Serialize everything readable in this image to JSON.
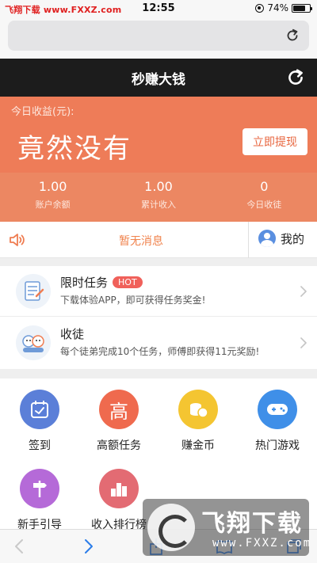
{
  "status_bar": {
    "watermark_prefix": "飞翔下载",
    "watermark_url": "www.FXXZ.com",
    "time": "12:55",
    "battery": "74%",
    "battery_level": 0.74
  },
  "app_bar": {
    "title": "秒赚大钱"
  },
  "earnings": {
    "label": "今日收益(元):",
    "amount_text": "竟然没有",
    "withdraw_label": "立即提现",
    "stats": [
      {
        "value": "1.00",
        "label": "账户余额"
      },
      {
        "value": "1.00",
        "label": "累计收入"
      },
      {
        "value": "0",
        "label": "今日收徒"
      }
    ]
  },
  "notice": {
    "message": "暂无消息",
    "mine_label": "我的"
  },
  "tasks": [
    {
      "title": "限时任务",
      "badge": "HOT",
      "desc": "下载体验APP，即可获得任务奖金!"
    },
    {
      "title": "收徒",
      "badge": "",
      "desc": "每个徒弟完成10个任务，师傅即获得11元奖励!"
    }
  ],
  "grid": [
    {
      "label": "签到",
      "icon": "calendar-check-icon",
      "color": "#5b7fd8",
      "glyph": ""
    },
    {
      "label": "高额任务",
      "icon": "high-task-icon",
      "color": "#ef6a4e",
      "glyph": "高"
    },
    {
      "label": "赚金币",
      "icon": "coin-icon",
      "color": "#f4c531",
      "glyph": ""
    },
    {
      "label": "热门游戏",
      "icon": "gamepad-icon",
      "color": "#3f8fe8",
      "glyph": ""
    },
    {
      "label": "新手引导",
      "icon": "signpost-icon",
      "color": "#b56ad8",
      "glyph": ""
    },
    {
      "label": "收入排行榜",
      "icon": "ranking-icon",
      "color": "#e36b73",
      "glyph": ""
    }
  ],
  "watermark": {
    "title": "飞翔下载",
    "url": "www.FXXZ.com"
  }
}
